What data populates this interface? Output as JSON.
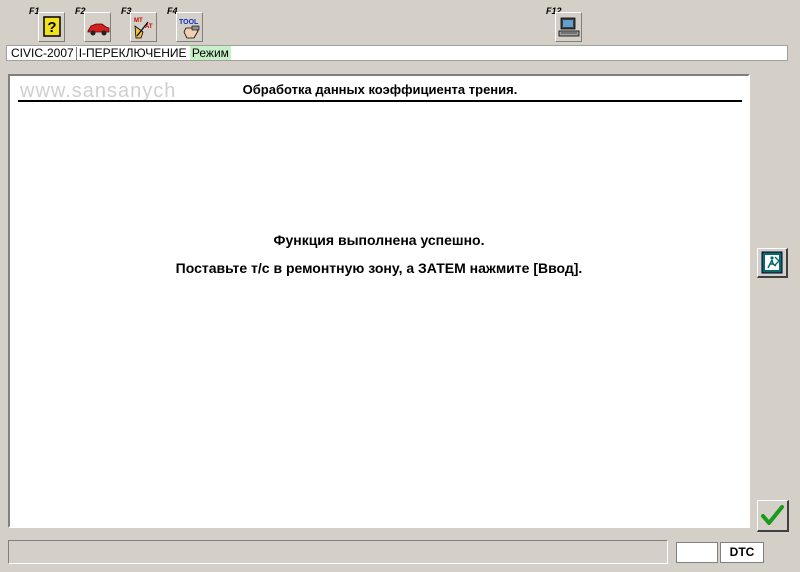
{
  "toolbar": {
    "f1": {
      "key": "F1",
      "icon": "help-question-icon"
    },
    "f2": {
      "key": "F2",
      "icon": "car-icon"
    },
    "f3": {
      "key": "F3",
      "icon": "mt-at-select-icon"
    },
    "f4": {
      "key": "F4",
      "icon": "tool-icon"
    },
    "f12": {
      "key": "F12",
      "icon": "print-computer-icon"
    }
  },
  "status": {
    "vehicle": "CIVIC-2007",
    "system": "I-ПЕРЕКЛЮЧЕНИЕ",
    "mode": "Режим"
  },
  "watermark": "www.sansanych",
  "panel": {
    "title": "Обработка данных коэффициента трения.",
    "message_line1": "Функция выполнена успешно.",
    "message_line2": "Поставьте т/с в ремонтную зону, а ЗАТЕМ нажмите [Ввод]."
  },
  "side_buttons": {
    "exit_icon": "exit-door-icon",
    "enter_icon": "checkmark-icon"
  },
  "bottom": {
    "dtc_label": "DTC",
    "empty_value": ""
  },
  "colors": {
    "window_bg": "#d4d0c8",
    "mode_highlight": "#c8f0c8",
    "check_green": "#1a9a1a",
    "exit_teal": "#0a6a6a"
  }
}
